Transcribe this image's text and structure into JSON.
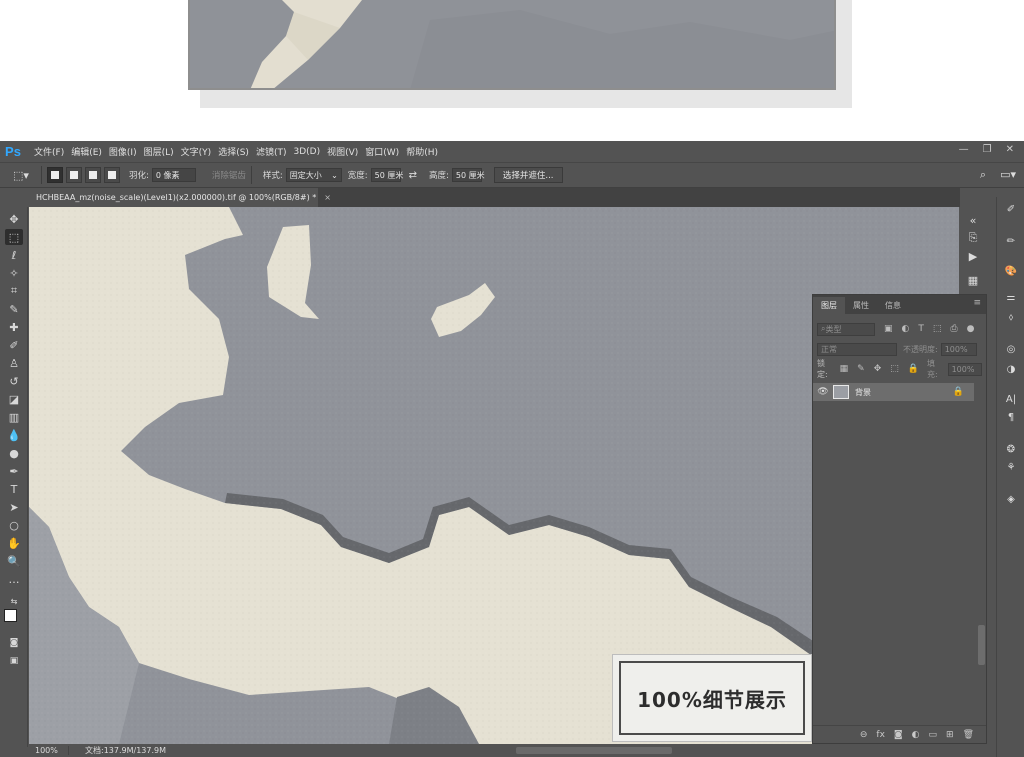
{
  "menubar": {
    "app_logo": "Ps",
    "items": [
      "文件(F)",
      "编辑(E)",
      "图像(I)",
      "图层(L)",
      "文字(Y)",
      "选择(S)",
      "滤镜(T)",
      "3D(D)",
      "视图(V)",
      "窗口(W)",
      "帮助(H)"
    ],
    "window_controls": [
      "minimize-icon",
      "restore-icon",
      "close-icon"
    ]
  },
  "options_bar": {
    "tool_icon": "rectangular-marquee-icon",
    "feather_label": "羽化:",
    "feather_value": "0 像素",
    "antialias_label": "消除锯齿",
    "style_label": "样式:",
    "style_value": "固定大小",
    "width_label": "宽度:",
    "width_value": "50 厘米",
    "height_label": "高度:",
    "height_value": "50 厘米",
    "select_mask_button": "选择并遮住..."
  },
  "document_tab": {
    "title": "HCHBEAA_mz(noise_scale)(Level1)(x2.000000).tif @ 100%(RGB/8#) *",
    "close": "×"
  },
  "canvas": {
    "watermark_text": "100%细节展示",
    "colors": {
      "grey": "#90939a",
      "cream": "#e5e1d3",
      "shadow": "#6a6c70"
    }
  },
  "status_bar": {
    "zoom": "100%",
    "doc_size": "文档:137.9M/137.9M"
  },
  "layers_panel": {
    "tabs": [
      "图层",
      "属性",
      "信息"
    ],
    "filter_placeholder": "类型",
    "blend_mode": "正常",
    "opacity_label": "不透明度:",
    "opacity_value": "100%",
    "lock_label": "锁定:",
    "fill_label": "填充:",
    "fill_value": "100%",
    "layers": [
      {
        "name": "背景",
        "visible": true,
        "locked": true
      }
    ]
  }
}
